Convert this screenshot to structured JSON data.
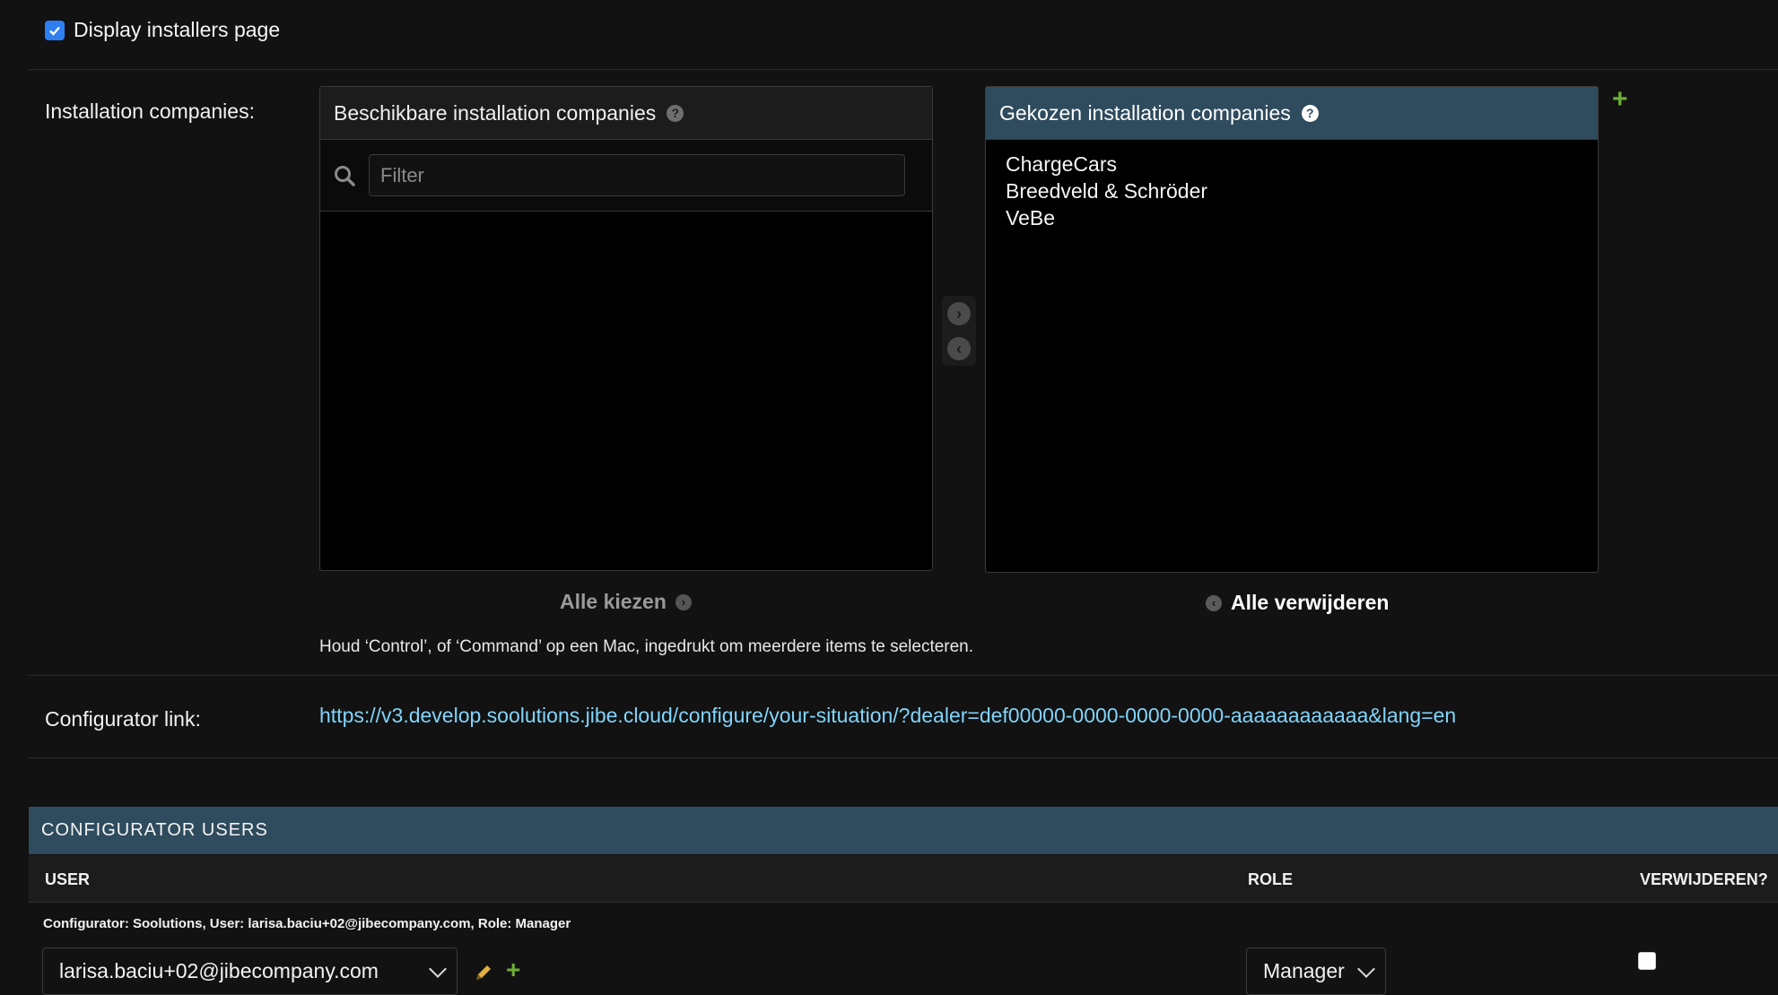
{
  "display_installers": {
    "label": "Display installers page",
    "checked": true
  },
  "installation_companies": {
    "label": "Installation companies:",
    "available": {
      "title": "Beschikbare installation companies",
      "filter_placeholder": "Filter",
      "items": []
    },
    "chosen": {
      "title": "Gekozen installation companies",
      "items": [
        "ChargeCars",
        "Breedveld & Schröder",
        "VeBe"
      ]
    },
    "choose_all": "Alle kiezen",
    "remove_all": "Alle verwijderen",
    "help_text": "Houd ‘Control’, of ‘Command’ op een Mac, ingedrukt om meerdere items te selecteren."
  },
  "configurator_link": {
    "label": "Configurator link:",
    "url": "https://v3.develop.soolutions.jibe.cloud/configure/your-situation/?dealer=def00000-0000-0000-0000-aaaaaaaaaaaa&lang=en"
  },
  "configurator_users": {
    "title": "CONFIGURATOR USERS",
    "columns": {
      "user": "USER",
      "role": "ROLE",
      "delete": "VERWIJDEREN?"
    },
    "rows": [
      {
        "caption": "Configurator: Soolutions, User: larisa.baciu+02@jibecompany.com, Role: Manager",
        "user": "larisa.baciu+02@jibecompany.com",
        "role": "Manager",
        "delete": false
      }
    ]
  },
  "colors": {
    "accent_header": "#2f4b5e",
    "link": "#81d4fa",
    "add_green": "#6dae35",
    "checkbox_blue": "#2d7ff2"
  }
}
